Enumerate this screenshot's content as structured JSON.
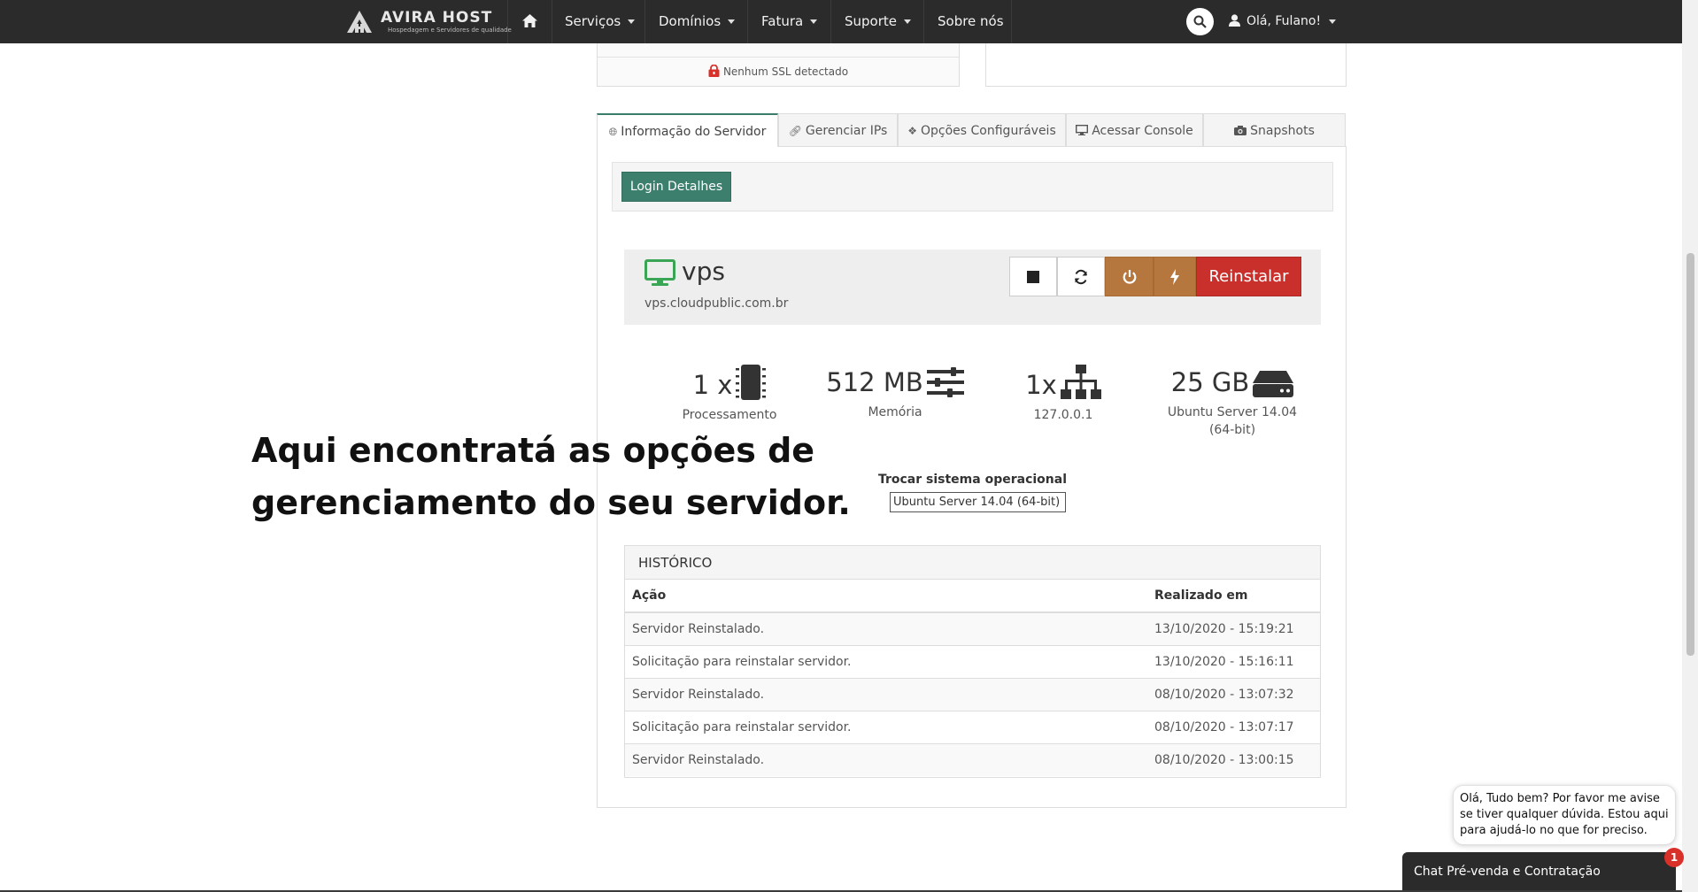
{
  "navbar": {
    "brand": "AVIRA HOST",
    "tagline": "Hospedagem e Servidores de qualidade",
    "items": [
      {
        "label": "Serviços"
      },
      {
        "label": "Domínios"
      },
      {
        "label": "Fatura"
      },
      {
        "label": "Suporte"
      },
      {
        "label": "Sobre nós"
      }
    ],
    "user_greeting": "Olá, Fulano!"
  },
  "ssl": {
    "text": "Nenhum SSL detectado"
  },
  "tabs": [
    {
      "label": "Informação do Servidor",
      "icon": "globe-icon",
      "active": true
    },
    {
      "label": "Gerenciar IPs",
      "icon": "link-icon"
    },
    {
      "label": "Opções Configuráveis",
      "icon": "cubes-icon"
    },
    {
      "label": "Acessar Console",
      "icon": "desktop-icon"
    },
    {
      "label": "Snapshots",
      "icon": "camera-icon"
    }
  ],
  "login_button": "Login Detalhes",
  "server": {
    "name": "vps",
    "hostname": "vps.cloudpublic.com.br",
    "reinstall_label": "Reinstalar"
  },
  "stats": {
    "cpu": {
      "value": "1 x",
      "label": "Processamento"
    },
    "memory": {
      "value": "512 MB",
      "label": "Memória"
    },
    "ip": {
      "value": "1x",
      "label": "127.0.0.1"
    },
    "disk": {
      "value": "25 GB",
      "label": "Ubuntu Server 14.04 (64-bit)"
    }
  },
  "os": {
    "label": "Trocar sistema operacional",
    "selected": "Ubuntu Server 14.04 (64-bit)"
  },
  "history": {
    "title": "HISTÓRICO",
    "columns": [
      "Ação",
      "Realizado em"
    ],
    "rows": [
      [
        "Servidor Reinstalado.",
        "13/10/2020 - 15:19:21"
      ],
      [
        "Solicitação para reinstalar servidor.",
        "13/10/2020 - 15:16:11"
      ],
      [
        "Servidor Reinstalado.",
        "08/10/2020 - 13:07:32"
      ],
      [
        "Solicitação para reinstalar servidor.",
        "08/10/2020 - 13:07:17"
      ],
      [
        "Servidor Reinstalado.",
        "08/10/2020 - 13:00:15"
      ]
    ]
  },
  "annotation": {
    "line1": "Aqui encontratá as opções de",
    "line2": "gerenciamento do seu servidor."
  },
  "chat": {
    "bubble": "Olá, Tudo bem? Por favor me avise se tiver qualquer dúvida. Estou aqui para ajudá-lo no que for preciso.",
    "bar_label": "Chat Pré-venda e Contratação",
    "badge": "1"
  },
  "colors": {
    "navbar": "#2b2b2b",
    "login_button": "#3d7f6d",
    "power_buttons": "#b5773e",
    "reinstall_button": "#c9302c",
    "monitor_icon": "#3aa655",
    "badge": "#d9302a"
  }
}
